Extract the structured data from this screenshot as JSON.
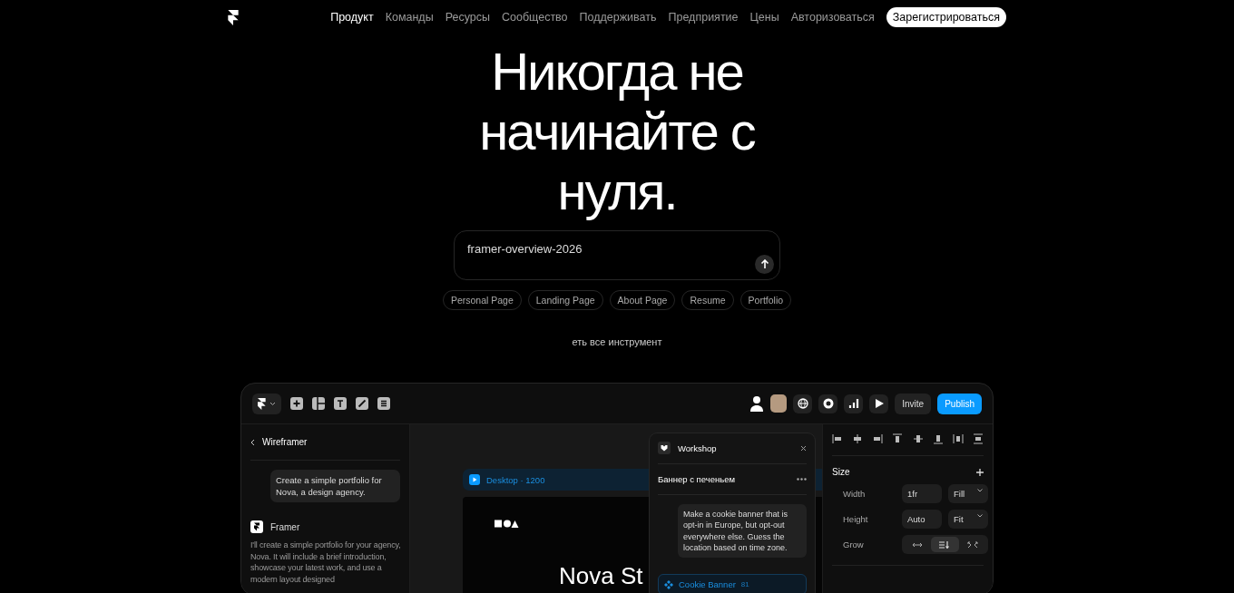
{
  "nav": {
    "links": [
      {
        "label": "Продукт",
        "selected": true
      },
      {
        "label": "Команды",
        "selected": false
      },
      {
        "label": "Ресурсы",
        "selected": false
      },
      {
        "label": "Сообщество",
        "selected": false
      },
      {
        "label": "Поддерживать",
        "selected": false
      },
      {
        "label": "Предприятие",
        "selected": false
      },
      {
        "label": "Цены",
        "selected": false
      }
    ],
    "login": "Авторизоваться",
    "signup": "Зарегистрироваться"
  },
  "hero": {
    "title": "Никогда не начинайте с нуля.",
    "prompt": {
      "value": "framer-overview-2026"
    },
    "chips": [
      "Personal Page",
      "Landing Page",
      "About Page",
      "Resume",
      "Portfolio"
    ],
    "more": "еть все инструмент"
  },
  "app": {
    "toolbar": {
      "invite": "Invite",
      "publish": "Publish"
    },
    "sidebar": {
      "title": "Wireframer",
      "user_message": "Create a simple portfolio for Nova, a design agency.",
      "assistant": "Framer",
      "reply": "I'll create a simple portfolio for your agency, Nova. It will include a brief introduction, showcase your latest work, and use a modern layout designed"
    },
    "canvas": {
      "frame_label": "Desktop · 1200",
      "heading": "Nova St"
    },
    "workshop": {
      "title": "Workshop",
      "subtitle": "Баннер с печеньем",
      "message": "Make a cookie banner that is opt-in in Europe, but opt-out everywhere else. Guess the location based on time zone.",
      "component": "Cookie Banner",
      "component_count": "81"
    },
    "properties": {
      "section": "Size",
      "rows": [
        {
          "label": "Width",
          "value": "1fr",
          "mode": "Fill"
        },
        {
          "label": "Height",
          "value": "Auto",
          "mode": "Fit"
        }
      ],
      "grow": {
        "label": "Grow",
        "options": [
          {
            "kind": "horizontal",
            "selected": false
          },
          {
            "kind": "stack",
            "selected": true
          },
          {
            "kind": "expand",
            "selected": false
          }
        ]
      }
    }
  }
}
